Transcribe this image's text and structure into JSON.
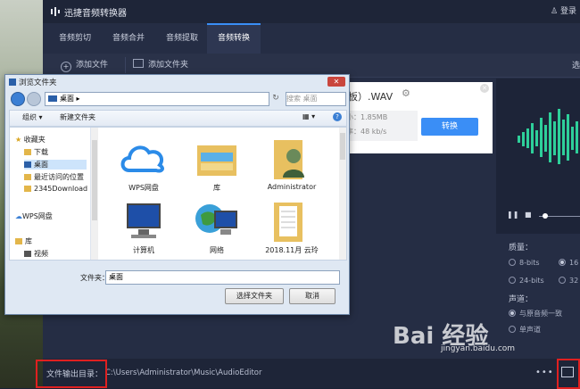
{
  "app": {
    "title": "迅捷音频转换器",
    "user_label": "登录"
  },
  "tabs": [
    {
      "label": "音频剪切"
    },
    {
      "label": "音频合并"
    },
    {
      "label": "音频提取"
    },
    {
      "label": "音频转换"
    }
  ],
  "active_tab": "音频转换",
  "toolbar": {
    "add_file": "添加文件",
    "add_folder": "添加文件夹",
    "select_label": "选"
  },
  "file_card": {
    "name": "板）.WAV",
    "size": "小：1.85MB",
    "bitrate": "率：48 kb/s",
    "convert_label": "转换"
  },
  "settings": {
    "quality_label": "质量：",
    "options": [
      "8-bits",
      "16",
      "24-bits",
      "32"
    ],
    "channel_label": "声道：",
    "channel_options": [
      "与原音频一致",
      "单声道"
    ]
  },
  "bottom": {
    "output_label": "文件输出目录：",
    "output_path": "C:\\Users\\Administrator\\Music\\AudioEditor",
    "more": "•••"
  },
  "dialog": {
    "title": "浏览文件夹",
    "address": "桌面",
    "address_arrow": "▸",
    "search_placeholder": "搜索 桌面",
    "organize": "组织 ▾",
    "new_folder": "新建文件夹",
    "tree": [
      {
        "label": "收藏夹",
        "icon": "star-icon"
      },
      {
        "label": "下载",
        "icon": "folder-icon"
      },
      {
        "label": "桌面",
        "icon": "desktop-icon",
        "selected": true
      },
      {
        "label": "最近访问的位置",
        "icon": "folder-icon"
      },
      {
        "label": "2345Download",
        "icon": "folder-icon"
      },
      {
        "label": "WPS网盘",
        "icon": "cloud-icon"
      },
      {
        "label": "库",
        "icon": "library-icon"
      },
      {
        "label": "视频",
        "icon": "video-icon"
      }
    ],
    "items": [
      {
        "label": "WPS网盘",
        "icon": "cloud-icon"
      },
      {
        "label": "库",
        "icon": "library-folder-icon"
      },
      {
        "label": "Administrator",
        "icon": "user-folder-icon"
      },
      {
        "label": "计算机",
        "icon": "computer-icon"
      },
      {
        "label": "网络",
        "icon": "network-icon"
      },
      {
        "label": "2018.11月 云玲",
        "icon": "folder-documents-icon"
      }
    ],
    "filename_label": "文件夹：",
    "filename_value": "桌面",
    "select_button": "选择文件夹",
    "cancel_button": "取消"
  },
  "watermark": {
    "text": "Bai 经验",
    "url": "jingyan.baidu.com"
  },
  "colors": {
    "accent": "#3a8ef6",
    "app_bg": "#252d44",
    "highlight": "#e02020",
    "wave": "#2ecf9a"
  }
}
